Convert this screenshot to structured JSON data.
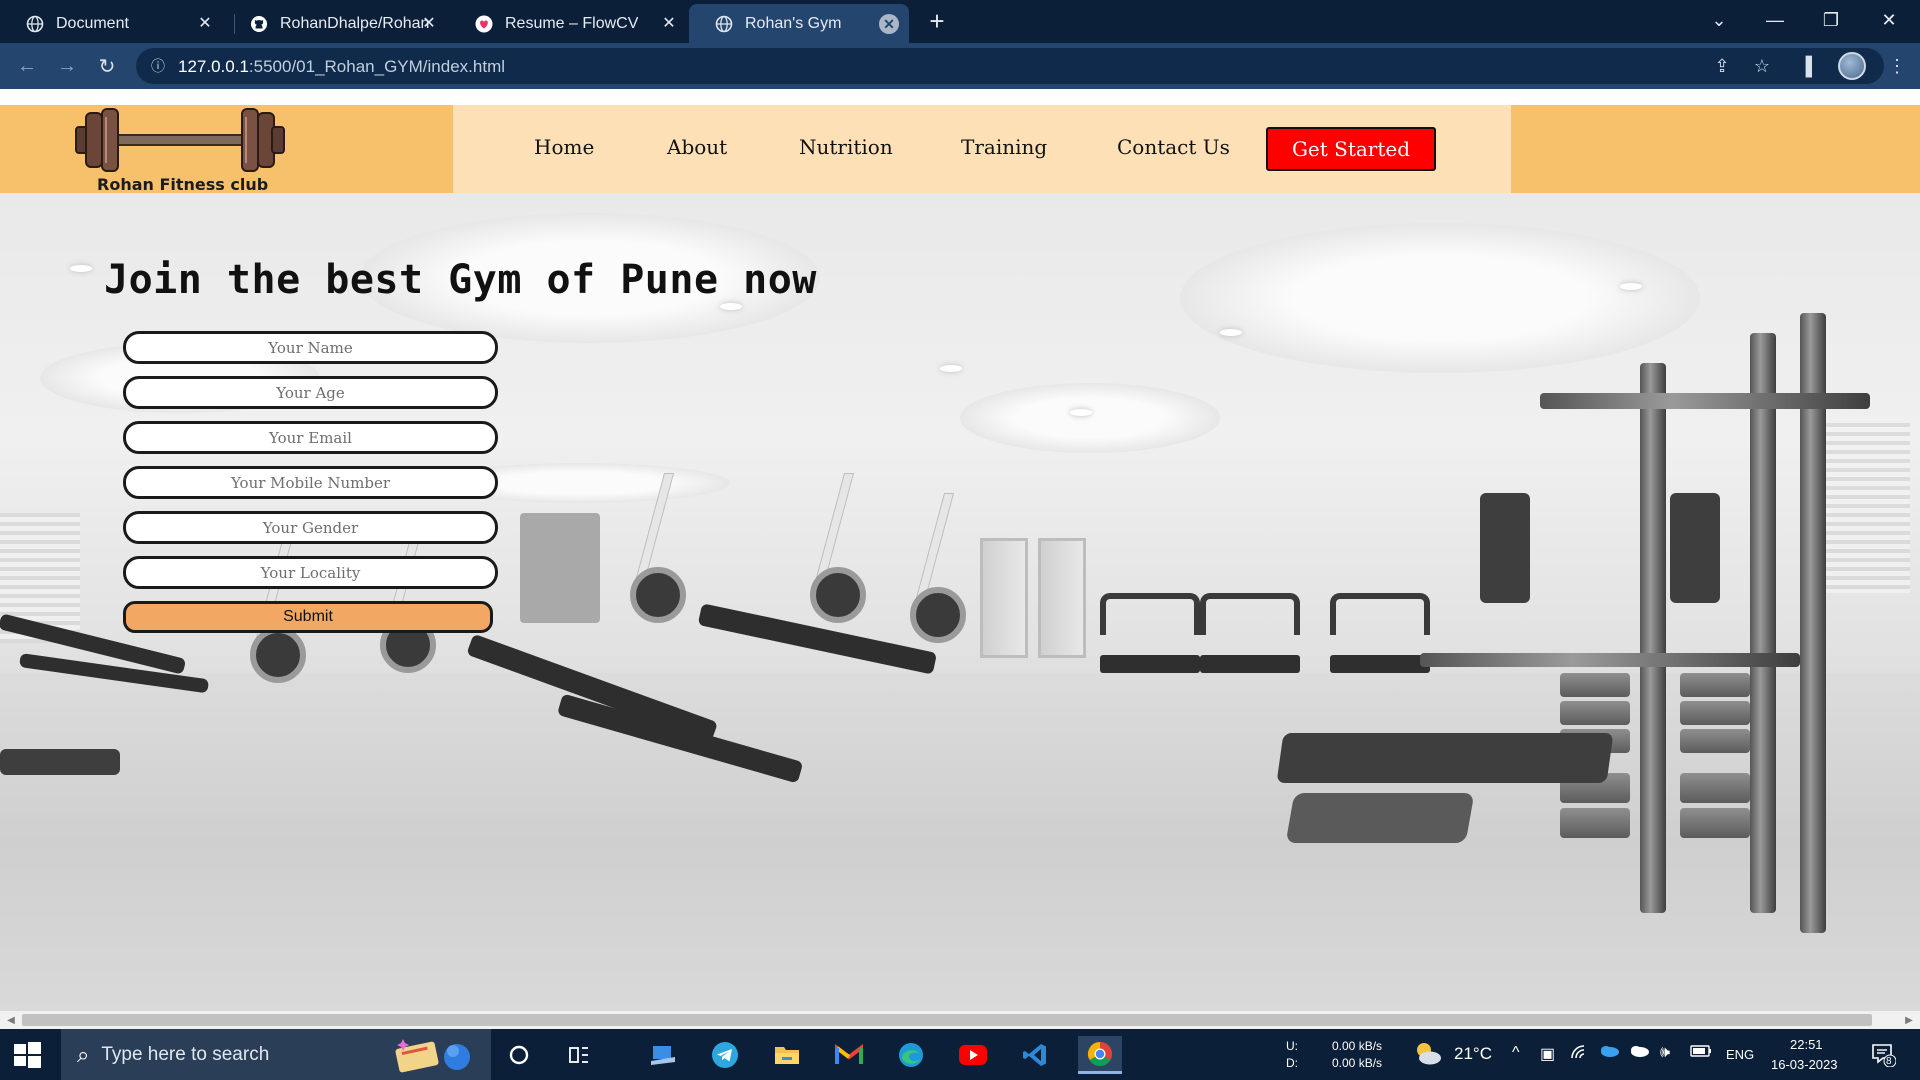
{
  "browser": {
    "tabs": [
      {
        "title": "Document",
        "icon": "globe-icon",
        "active": false
      },
      {
        "title": "RohanDhalpe/Rohan-",
        "icon": "github-icon",
        "active": false
      },
      {
        "title": "Resume – FlowCV",
        "icon": "flowcv-icon",
        "active": false
      },
      {
        "title": "Rohan's Gym",
        "icon": "globe-icon",
        "active": true
      }
    ],
    "new_tab_label": "+",
    "url_host": "127.0.0.1",
    "url_rest": ":5500/01_Rohan_GYM/index.html"
  },
  "site": {
    "logo_text": "Rohan Fitness club",
    "nav": {
      "home": "Home",
      "about": "About",
      "nutrition": "Nutrition",
      "training": "Training",
      "contact": "Contact Us",
      "cta": "Get Started"
    },
    "hero_title": "Join the best Gym of Pune now",
    "form": {
      "name_placeholder": "Your Name",
      "age_placeholder": "Your Age",
      "email_placeholder": "Your Email",
      "mobile_placeholder": "Your Mobile Number",
      "gender_placeholder": "Your Gender",
      "locality_placeholder": "Your Locality",
      "submit_label": "Submit"
    },
    "colors": {
      "header_bg": "#f7c16b",
      "nav_bg": "#fde0b5",
      "cta_bg": "#ff0000",
      "submit_bg": "#f2a862"
    }
  },
  "taskbar": {
    "search_placeholder": "Type here to search",
    "net_up": "U:",
    "net_down": "D:",
    "net_up_rate": "0.00 kB/s",
    "net_down_rate": "0.00 kB/s",
    "temperature": "21°C",
    "language": "ENG",
    "time": "22:51",
    "date": "16-03-2023",
    "notification_count": "8"
  }
}
